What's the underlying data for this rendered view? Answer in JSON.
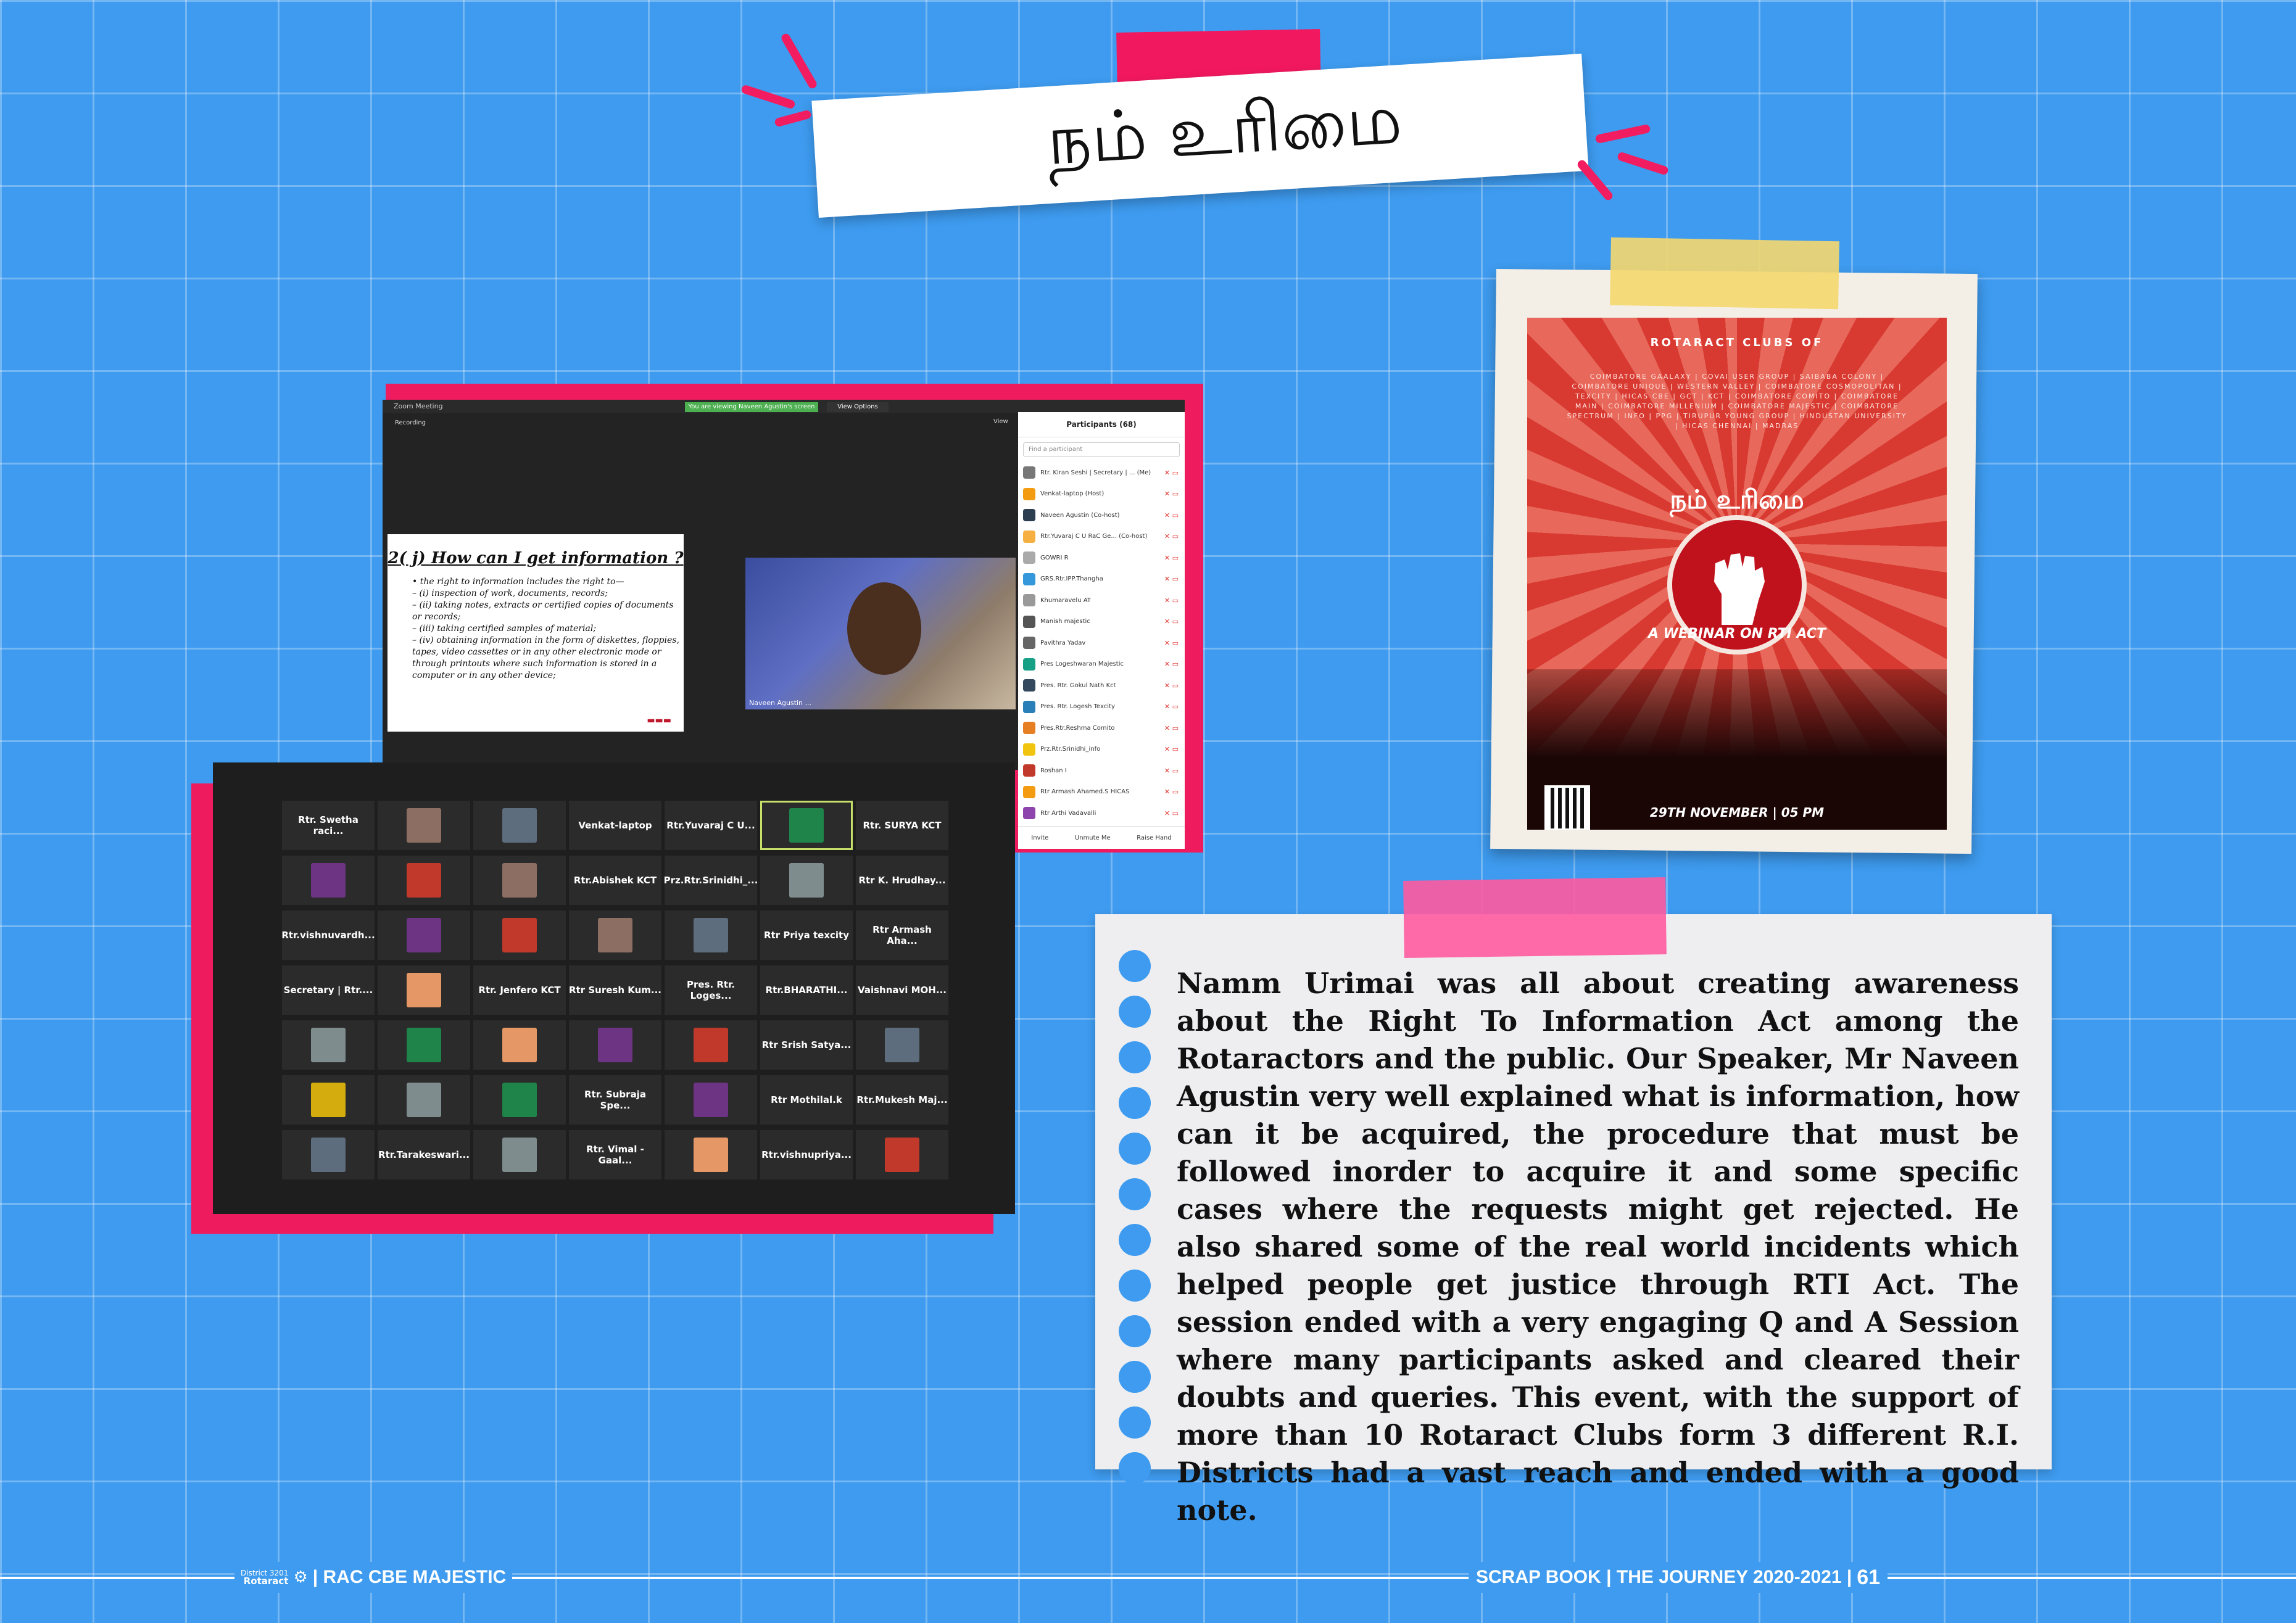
{
  "title": "நம் உரிமை",
  "zoom": {
    "window_title": "Zoom Meeting",
    "recording": "Recording",
    "view": "View",
    "notice": "You are viewing Naveen Agustin's screen",
    "view_options": "View Options",
    "slide": {
      "heading": "2( j) How can I get information ?",
      "lines": [
        "• the right to information includes the right to—",
        "– (i) inspection of work, documents, records;",
        "– (ii) taking notes, extracts or certified copies of documents or records;",
        "– (iii) taking certified samples of material;",
        "– (iv) obtaining information in the form of diskettes, floppies, tapes, video cassettes or in any other electronic mode or through printouts where such information is stored in a computer or in any other device;"
      ]
    },
    "speaker_label": "Naveen Agustin ...",
    "participants": {
      "header": "Participants (68)",
      "search_placeholder": "Find a participant",
      "rows": [
        "Rtr. Kiran Seshi | Secretary | ... (Me)",
        "Venkat-laptop (Host)",
        "Naveen Agustin (Co-host)",
        "Rtr.Yuvaraj C U RaC Ge... (Co-host)",
        "GOWRI R",
        "GRS.Rtr.IPP.Thangha",
        "Khumaravelu AT",
        "Manish majestic",
        "Pavithra Yadav",
        "Pres Logeshwaran Majestic",
        "Pres. Rtr. Gokul Nath Kct",
        "Pres. Rtr. Logesh Texcity",
        "Pres.Rtr.Reshma Comito",
        "Prz.Rtr.Srinidhi_info",
        "Roshan I",
        "Rtr Armash Ahamed.S HICAS",
        "Rtr Arthi Vadavalli"
      ],
      "footer": [
        "Invite",
        "Unmute Me",
        "Raise Hand"
      ]
    },
    "tiles": [
      "Rtr. Swetha raci...",
      "",
      "",
      "Venkat-laptop",
      "Rtr.Yuvaraj C U...",
      "",
      "Rtr. SURYA KCT",
      "",
      "",
      "",
      "Rtr.Abishek KCT",
      "Prz.Rtr.Srinidhi_...",
      "",
      "Rtr K. Hrudhay...",
      "Rtr.vishnuvardh...",
      "",
      "",
      "",
      "",
      "Rtr Priya texcity",
      "Rtr Armash Aha...",
      "Secretary | Rtr....",
      "",
      "Rtr. Jenfero KCT",
      "Rtr Suresh Kum...",
      "Pres. Rtr. Loges...",
      "Rtr.BHARATHI...",
      "Vaishnavi MOH...",
      "",
      "",
      "",
      "",
      "",
      "Rtr Srish Satya...",
      "",
      "",
      "",
      "",
      "Rtr. Subraja Spe...",
      "",
      "Rtr Mothilal.k",
      "Rtr.Mukesh Maj...",
      "",
      "Rtr.Tarakeswari...",
      "",
      "Rtr. Vimal - Gaal...",
      "",
      "Rtr.vishnupriya...",
      ""
    ]
  },
  "poster": {
    "top": "ROTARACT CLUBS OF",
    "clubs": "COIMBATORE GAALAXY | COVAI USER GROUP | SAIBABA COLONY | COIMBATORE UNIQUE | WESTERN VALLEY | COIMBATORE COSMOPOLITAN | TEXCITY | HICAS CBE | GCT | KCT | COIMBATORE COMITO | COIMBATORE MAIN | COIMBATORE MILLENIUM | COIMBATORE MAJESTIC | COIMBATORE SPECTRUM | INFO | PPG | TIRUPUR YOUNG GROUP | HINDUSTAN UNIVERSITY | HICAS CHENNAI | MADRAS",
    "title": "நம் உரிமை",
    "subtitle": "A WEBINAR ON RTI ACT",
    "date": "29TH NOVEMBER | 05 PM"
  },
  "note": {
    "text": "Namm Urimai was all about creating awareness about the Right To Information Act among the Rotaractors and the public. Our Speaker, Mr Naveen Agustin very well explained what is information, how can it be acquired, the procedure that must be followed inorder to acquire it and some specific cases where the requests might get rejected. He also shared some of the real world incidents which helped people get justice through RTI Act. The session ended with a very engaging Q and A Session where many participants asked and cleared their doubts and queries. This event, with the support of more than 10 Rotaract Clubs form 3 different R.I. Districts had a vast reach and ended with a good note."
  },
  "footer": {
    "district": "District 3201",
    "rotaract": "Rotaract",
    "club": "| RAC CBE MAJESTIC",
    "right": "SCRAP BOOK | THE JOURNEY 2020-2021 |",
    "page": "61"
  },
  "colors": {
    "background": "#3e9bef",
    "accent_pink": "#ee1b5f",
    "tape_yellow": "#f5d76e"
  }
}
